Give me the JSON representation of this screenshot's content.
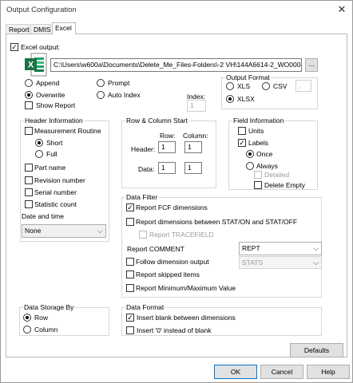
{
  "window": {
    "title": "Output Configuration",
    "close_glyph": "✕"
  },
  "tabs": [
    {
      "label": "Report"
    },
    {
      "label": "DMIS"
    },
    {
      "label": "Excel"
    }
  ],
  "excel": {
    "output_label": "Excel output:",
    "path": "C:\\Users\\w600a\\Documents\\Delete_Me_Files-Folders\\-2 VH\\144A6614-2_WO000438985",
    "browse_label": "...",
    "append_label": "Append",
    "overwrite_label": "Overwrite",
    "prompt_label": "Prompt",
    "auto_index_label": "Auto Index",
    "show_report_label": "Show Report",
    "index_label": "Index:",
    "index_value": "1"
  },
  "output_format": {
    "title": "Output Format",
    "xls_label": "XLS",
    "csv_label": "CSV",
    "csv_sep": ",",
    "xlsx_label": "XLSX"
  },
  "header_info": {
    "title": "Header Information",
    "measurement_routine": "Measurement Routine",
    "short": "Short",
    "full": "Full",
    "part_name": "Part name",
    "revision_number": "Revision number",
    "serial_number": "Serial number",
    "statistic_count": "Statistic count",
    "date_time_label": "Date and time",
    "date_time_value": "None"
  },
  "row_col": {
    "title": "Row & Column Start",
    "row_label": "Row:",
    "column_label": "Column:",
    "header_label": "Header:",
    "data_label": "Data:",
    "header_row": "1",
    "header_col": "1",
    "data_row": "1",
    "data_col": "1"
  },
  "field_info": {
    "title": "Field Information",
    "units": "Units",
    "labels": "Labels",
    "once": "Once",
    "always": "Always",
    "detailed": "Detailed",
    "delete_empty": "Delete Empty"
  },
  "data_filter": {
    "title": "Data Filter",
    "report_fcf": "Report FCF dimensions",
    "report_between": "Report dimensions between STAT/ON and STAT/OFF",
    "report_tracefield": "Report TRACEFIELD",
    "report_comment_label": "Report COMMENT",
    "report_comment_value": "REPT",
    "follow_dimension": "Follow dimension output",
    "follow_value": "STATS",
    "report_skipped": "Report skipped items",
    "report_minmax": "Report Minimum/Maximum Value"
  },
  "data_storage": {
    "title": "Data Storage By",
    "row": "Row",
    "column": "Column"
  },
  "data_format": {
    "title": "Data Format",
    "insert_blank": "Insert blank between dimensions",
    "insert_zero": "Insert '0' instead of blank"
  },
  "buttons": {
    "defaults": "Defaults",
    "ok": "OK",
    "cancel": "Cancel",
    "help": "Help"
  },
  "colors": {
    "excel_green": "#1e7145",
    "accent_blue": "#0078d7"
  }
}
